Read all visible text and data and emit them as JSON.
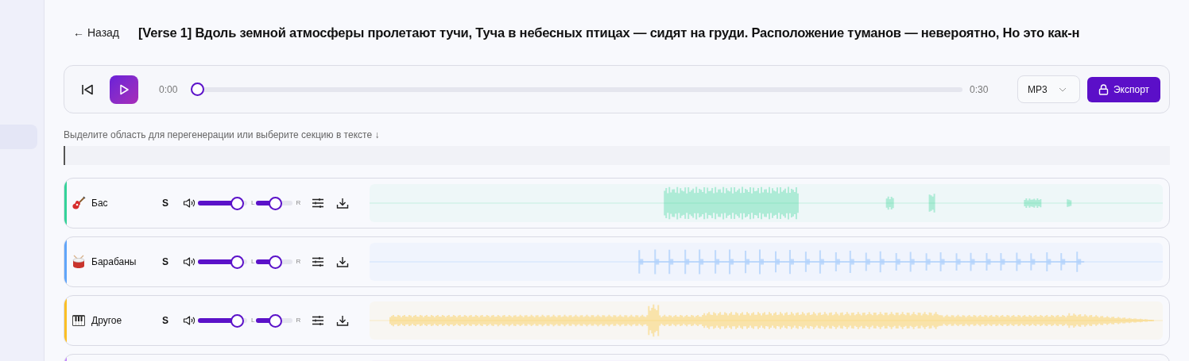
{
  "back_link": "← Назад",
  "title": "[Verse 1] Вдоль земной атмосферы пролетают тучи, Туча в небесных птицах — сидят на груди. Расположение туманов — невероятно, Но это как-н",
  "player": {
    "current_time": "0:00",
    "total_time": "0:30",
    "level": 0,
    "format": "MP3",
    "export_label": "Экспорт"
  },
  "hint": "Выделите область для перегенерации или выберите секцию в тексте ↓",
  "tracks": [
    {
      "kind": "full",
      "name": "Бас",
      "color": "#34d399",
      "solo": "S",
      "volume": {
        "level": 0.92
      },
      "pan": {
        "level": 0.52
      },
      "pan_left": "L",
      "pan_right": "R"
    },
    {
      "kind": "full",
      "name": "Барабаны",
      "color": "#60a5fa",
      "solo": "S",
      "volume": {
        "level": 0.92
      },
      "pan": {
        "level": 0.52
      },
      "pan_left": "L",
      "pan_right": "R"
    },
    {
      "kind": "full",
      "name": "Другое",
      "color": "#fbbf24",
      "solo": "S",
      "volume": {
        "level": 0.92
      },
      "pan": {
        "level": 0.52
      },
      "pan_left": "L",
      "pan_right": "R"
    },
    {
      "kind": "partial",
      "color": "#c084fc"
    }
  ]
}
